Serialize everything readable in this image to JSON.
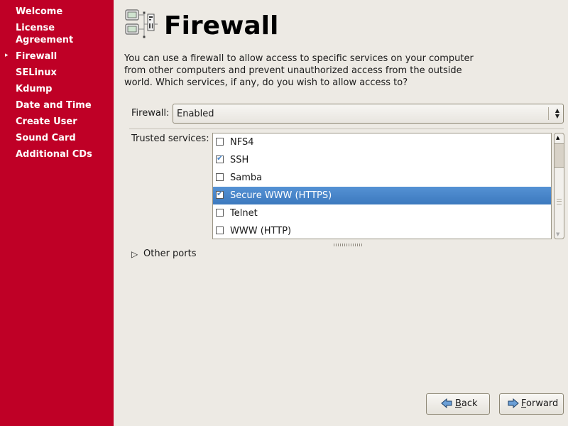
{
  "sidebar": {
    "items": [
      {
        "label": "Welcome",
        "current": false
      },
      {
        "label": "License\nAgreement",
        "current": false
      },
      {
        "label": "Firewall",
        "current": true
      },
      {
        "label": "SELinux",
        "current": false
      },
      {
        "label": "Kdump",
        "current": false
      },
      {
        "label": "Date and Time",
        "current": false
      },
      {
        "label": "Create User",
        "current": false
      },
      {
        "label": "Sound Card",
        "current": false
      },
      {
        "label": "Additional CDs",
        "current": false
      }
    ],
    "current_marker": "▸",
    "background": "#bf0026"
  },
  "header": {
    "icon": "network-firewall-icon",
    "title": "Firewall"
  },
  "description": "You can use a firewall to allow access to specific services on your computer\nfrom other computers and prevent unauthorized access from the outside\nworld.  Which services, if any, do you wish to allow access to?",
  "firewall": {
    "label": "Firewall:",
    "value": "Enabled"
  },
  "trusted_services": {
    "label": "Trusted services:",
    "items": [
      {
        "label": "NFS4",
        "checked": false,
        "selected": false
      },
      {
        "label": "SSH",
        "checked": true,
        "selected": false
      },
      {
        "label": "Samba",
        "checked": false,
        "selected": false
      },
      {
        "label": "Secure WWW (HTTPS)",
        "checked": true,
        "selected": true
      },
      {
        "label": "Telnet",
        "checked": false,
        "selected": false
      },
      {
        "label": "WWW (HTTP)",
        "checked": false,
        "selected": false
      }
    ],
    "selection_color": "#4a86c8"
  },
  "other_ports": {
    "label": "Other ports",
    "expanded": false
  },
  "buttons": {
    "back": {
      "mnemonic": "B",
      "rest": "ack"
    },
    "forward": {
      "mnemonic": "F",
      "rest": "orward"
    }
  }
}
